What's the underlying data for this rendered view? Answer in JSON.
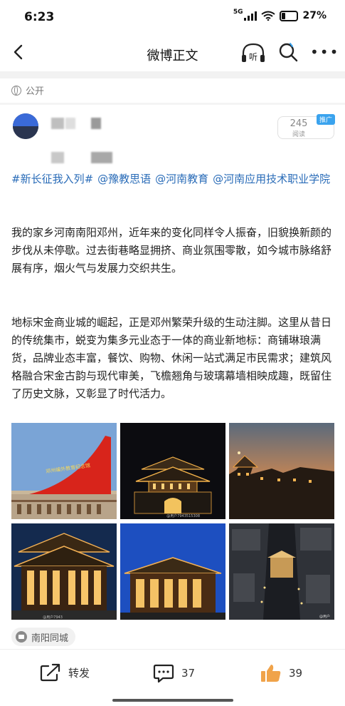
{
  "status": {
    "time": "6:23",
    "network": "5G",
    "battery": "27%"
  },
  "nav": {
    "title": "微博正文",
    "listen_label": "听"
  },
  "post": {
    "visibility": "公开",
    "read_count": "245",
    "read_label": "阅读",
    "promo_badge": "推广",
    "hashtags": [
      "#新长征我入列#",
      "@豫教思语",
      "@河南教育",
      "@河南应用技术职业学院"
    ],
    "paragraphs": [
      "我的家乡河南南阳邓州，近年来的变化同样令人振奋，旧貌换新颜的步伐从未停歇。过去街巷略显拥挤、商业氛围零散，如今城市脉络舒展有序，烟火气与发展力交织共生。",
      "地标宋金商业城的崛起，正是邓州繁荣升级的生动注脚。这里从昔日的传统集市，蜕变为集多元业态于一体的商业新地标：商铺琳琅满货，品牌业态丰富，餐饮、购物、休闲一站式满足市民需求；建筑风格融合宋金古韵与现代审美，飞檐翘角与玻璃幕墙相映成趣，既留住了历史文脉，又彰显了时代活力。"
    ],
    "photos": [
      {
        "sign_text": "邓州编外教育纪念馆",
        "watermark": ""
      },
      {
        "sign_text": "",
        "watermark": "@用户7943515308"
      },
      {
        "sign_text": "",
        "watermark": ""
      },
      {
        "sign_text": "",
        "watermark": "@用户7943"
      },
      {
        "sign_text": "",
        "watermark": ""
      },
      {
        "sign_text": "",
        "watermark": "@用户"
      }
    ],
    "location": "南阳同城"
  },
  "actions": {
    "repost_label": "转发",
    "comment_count": "37",
    "like_count": "39"
  },
  "colors": {
    "link": "#2a6cb8",
    "badge": "#3aa3ee",
    "like": "#f0a34a"
  }
}
